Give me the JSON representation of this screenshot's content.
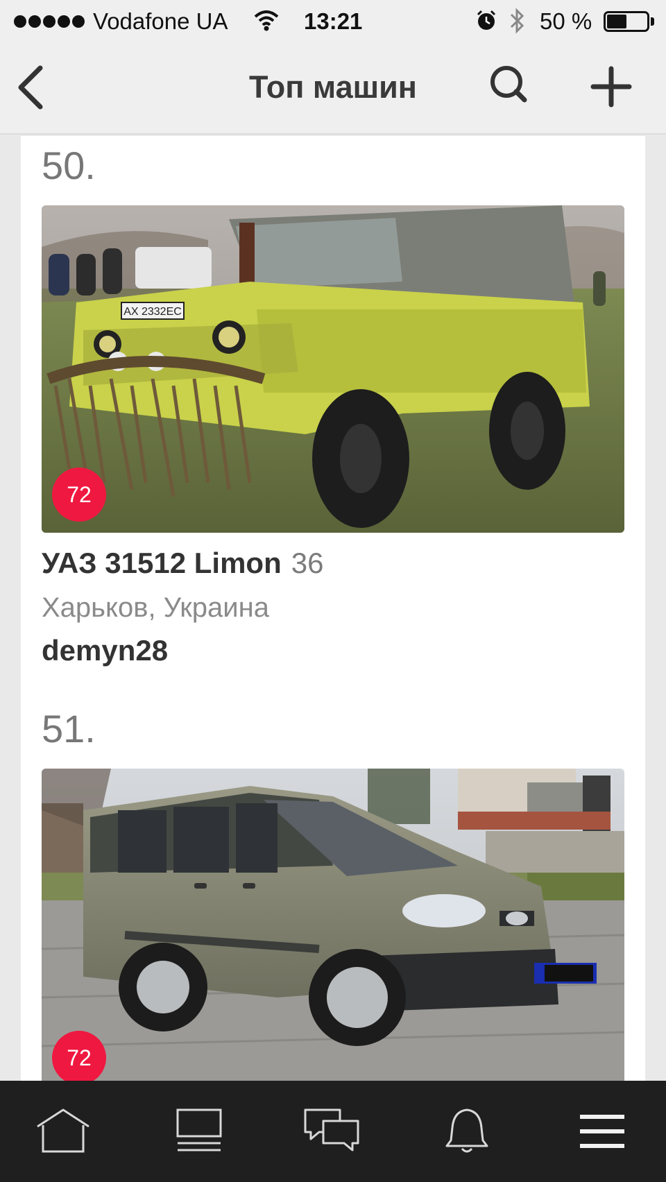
{
  "status_bar": {
    "carrier": "Vodafone UA",
    "time": "13:21",
    "battery_percent_text": "50 %",
    "battery_level": 0.5
  },
  "nav": {
    "title": "Топ машин",
    "back_icon": "chevron-left-icon",
    "search_icon": "search-icon",
    "add_icon": "plus-icon"
  },
  "cars": [
    {
      "rank": "50.",
      "badge": "72",
      "name": "УАЗ 31512 Limon",
      "count": "36",
      "location": "Харьков, Украина",
      "owner": "demyn28",
      "plate": "AX 2332EC"
    },
    {
      "rank": "51.",
      "badge": "72"
    }
  ],
  "tab_bar": {
    "items": [
      "home-icon",
      "feed-icon",
      "messages-icon",
      "notifications-icon",
      "menu-icon"
    ]
  },
  "colors": {
    "accent": "#ef1840",
    "tab_bar_bg": "#1f1f1f"
  }
}
